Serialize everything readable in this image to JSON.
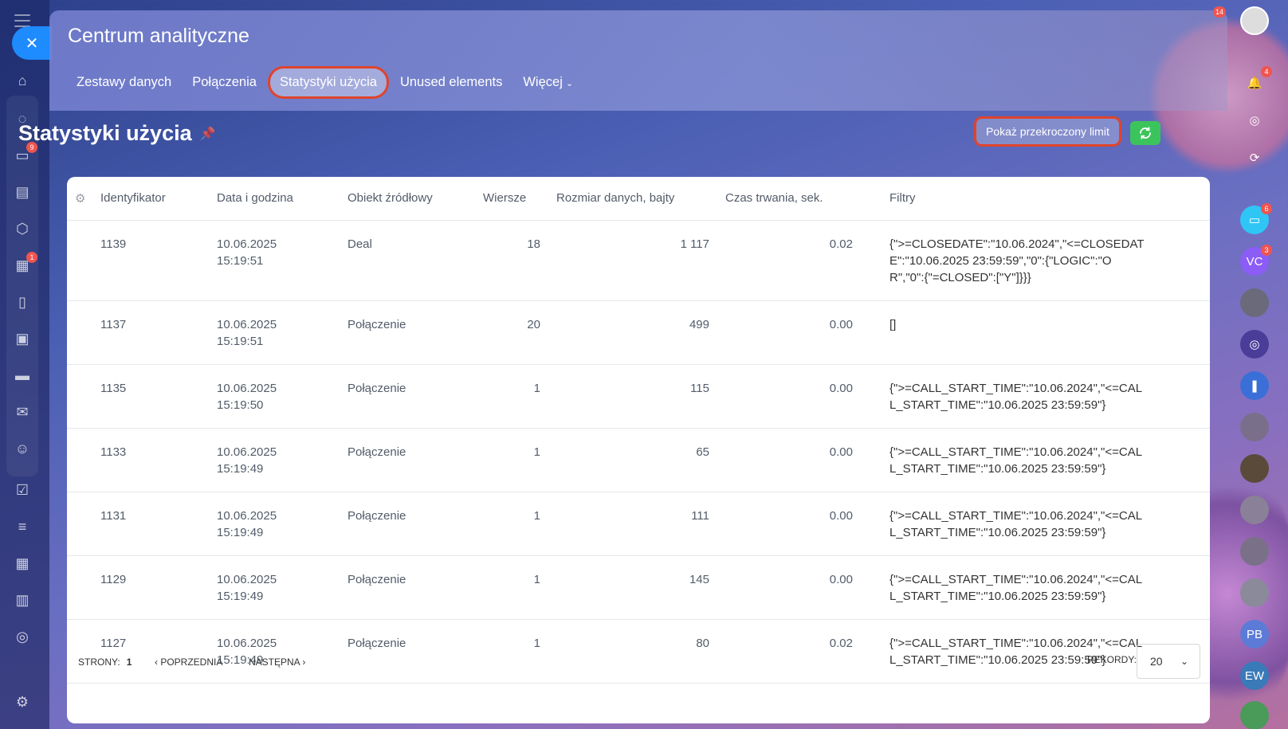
{
  "app_title": "Centrum analityczne",
  "tabs": [
    {
      "label": "Zestawy danych",
      "active": false
    },
    {
      "label": "Połączenia",
      "active": false
    },
    {
      "label": "Statystyki użycia",
      "active": true
    },
    {
      "label": "Unused elements",
      "active": false
    },
    {
      "label": "Więcej",
      "active": false
    }
  ],
  "page_title": "Statystyki użycia",
  "buttons": {
    "show_limit": "Pokaż przekroczony limit"
  },
  "left_bar": {
    "badges": {
      "chat": "9",
      "calendar": "1"
    }
  },
  "right_bar": {
    "top_badge": "14",
    "notifications_badge": "4",
    "chat_badge": "6",
    "vc_initials": "VC",
    "vc_badge": "3",
    "pb_initials": "PB",
    "ew_initials": "EW"
  },
  "table": {
    "columns": [
      "Identyfikator",
      "Data i godzina",
      "Obiekt źródłowy",
      "Wiersze",
      "Rozmiar danych, bajty",
      "Czas trwania, sek.",
      "Filtry"
    ],
    "rows": [
      {
        "id": "1139",
        "date": "10.06.2025",
        "time": "15:19:51",
        "object": "Deal",
        "rows": "18",
        "size": "1 117",
        "duration": "0.02",
        "filters": "{\">=CLOSEDATE\":\"10.06.2024\",\"<=CLOSEDATE\":\"10.06.2025 23:59:59\",\"0\":{\"LOGIC\":\"OR\",\"0\":{\"=CLOSED\":[\"Y\"]}}}"
      },
      {
        "id": "1137",
        "date": "10.06.2025",
        "time": "15:19:51",
        "object": "Połączenie",
        "rows": "20",
        "size": "499",
        "duration": "0.00",
        "filters": "[]"
      },
      {
        "id": "1135",
        "date": "10.06.2025",
        "time": "15:19:50",
        "object": "Połączenie",
        "rows": "1",
        "size": "115",
        "duration": "0.00",
        "filters": "{\">=CALL_START_TIME\":\"10.06.2024\",\"<=CALL_START_TIME\":\"10.06.2025 23:59:59\"}"
      },
      {
        "id": "1133",
        "date": "10.06.2025",
        "time": "15:19:49",
        "object": "Połączenie",
        "rows": "1",
        "size": "65",
        "duration": "0.00",
        "filters": "{\">=CALL_START_TIME\":\"10.06.2024\",\"<=CALL_START_TIME\":\"10.06.2025 23:59:59\"}"
      },
      {
        "id": "1131",
        "date": "10.06.2025",
        "time": "15:19:49",
        "object": "Połączenie",
        "rows": "1",
        "size": "111",
        "duration": "0.00",
        "filters": "{\">=CALL_START_TIME\":\"10.06.2024\",\"<=CALL_START_TIME\":\"10.06.2025 23:59:59\"}"
      },
      {
        "id": "1129",
        "date": "10.06.2025",
        "time": "15:19:49",
        "object": "Połączenie",
        "rows": "1",
        "size": "145",
        "duration": "0.00",
        "filters": "{\">=CALL_START_TIME\":\"10.06.2024\",\"<=CALL_START_TIME\":\"10.06.2025 23:59:59\"}"
      },
      {
        "id": "1127",
        "date": "10.06.2025",
        "time": "15:19:49",
        "object": "Połączenie",
        "rows": "1",
        "size": "80",
        "duration": "0.02",
        "filters": "{\">=CALL_START_TIME\":\"10.06.2024\",\"<=CALL_START_TIME\":\"10.06.2025 23:59:59\"}"
      }
    ]
  },
  "pager": {
    "pages_label": "STRONY:",
    "current_page": "1",
    "prev_label": "POPRZEDNIA",
    "next_label": "NASTĘPNA",
    "records_label": "REKORDY:",
    "records_value": "20"
  }
}
